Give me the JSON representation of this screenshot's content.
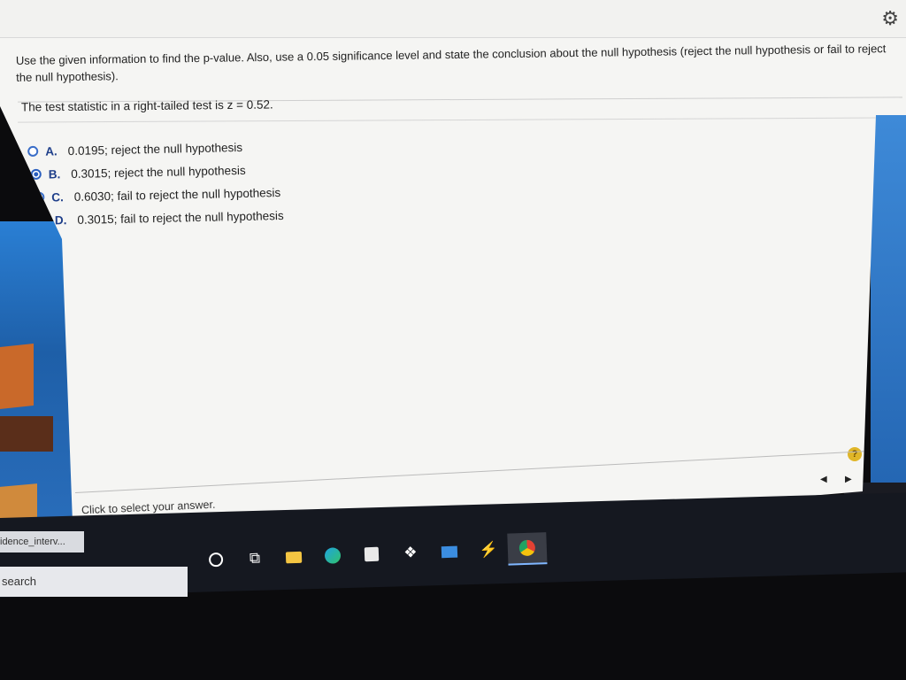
{
  "question": {
    "prompt": "Use the given information to find the p-value. Also, use a 0.05 significance level and state the conclusion about the null hypothesis (reject the null hypothesis or fail to reject the null hypothesis).",
    "statement": "The test statistic in a right-tailed test is z = 0.52."
  },
  "options": [
    {
      "letter": "A.",
      "text": "0.0195; reject the null hypothesis",
      "selected": false
    },
    {
      "letter": "B.",
      "text": "0.3015; reject the null hypothesis",
      "selected": true
    },
    {
      "letter": "C.",
      "text": "0.6030; fail to reject the null hypothesis",
      "selected": false
    },
    {
      "letter": "D.",
      "text": "0.3015; fail to reject the null hypothesis",
      "selected": false
    }
  ],
  "footer": {
    "hint": "Click to select your answer.",
    "help_symbol": "?",
    "prev_symbol": "◀",
    "next_symbol": "▶"
  },
  "taskbar": {
    "tab_label": "idence_interv...",
    "search_label": "search",
    "icons": [
      "cortana-icon",
      "task-view-icon",
      "file-explorer-icon",
      "edge-icon",
      "store-icon",
      "dropbox-icon",
      "mail-icon",
      "flash-icon",
      "chrome-icon"
    ]
  },
  "colors": {
    "accent": "#2a5fbf",
    "help_badge": "#e0b628",
    "taskbar": "#151820"
  }
}
